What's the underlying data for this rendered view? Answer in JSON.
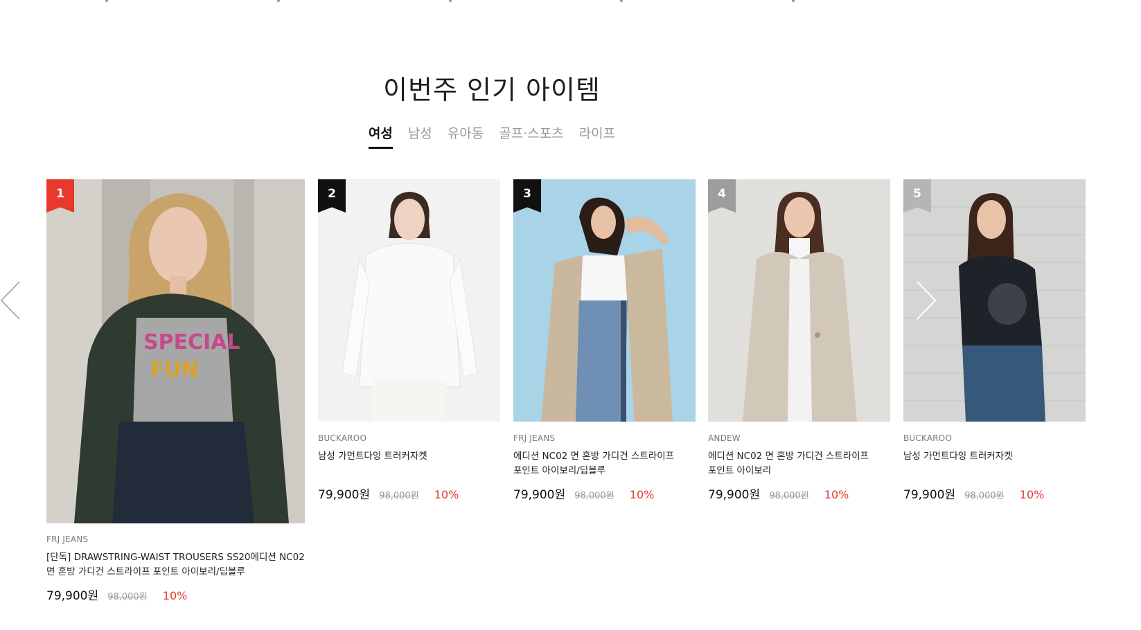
{
  "section": {
    "title": "이번주 인기 아이템"
  },
  "tabs": [
    {
      "label": "여성",
      "active": true
    },
    {
      "label": "남성",
      "active": false
    },
    {
      "label": "유아동",
      "active": false
    },
    {
      "label": "골프·스포츠",
      "active": false
    },
    {
      "label": "라이프",
      "active": false
    }
  ],
  "products": [
    {
      "rank": "1",
      "rank_color": "#e8392c",
      "brand": "FRJ JEANS",
      "name_line1": "[단독] DRAWSTRING-WAIST TROUSERS SS20에디션 NC02",
      "name_line2": "면 혼방 가디건 스트라이프 포인트 아이보리/딥블루",
      "price": "79,900원",
      "old_price": "98,000원",
      "discount": "10%"
    },
    {
      "rank": "2",
      "rank_color": "#111111",
      "brand": "BUCKAROO",
      "name_line1": "남성 가먼트다잉 트러커자켓",
      "name_line2": "",
      "price": "79,900원",
      "old_price": "98,000원",
      "discount": "10%"
    },
    {
      "rank": "3",
      "rank_color": "#111111",
      "brand": "FRJ JEANS",
      "name_line1": "에디션 NC02 면 혼방 가디건 스트라이프",
      "name_line2": "포인트 아이보리/딥블루",
      "price": "79,900원",
      "old_price": "98,000원",
      "discount": "10%"
    },
    {
      "rank": "4",
      "rank_color": "#9d9d9d",
      "brand": "ANDEW",
      "name_line1": "에디션 NC02 면 혼방 가디건 스트라이프",
      "name_line2": "포인트 아이보리",
      "price": "79,900원",
      "old_price": "98,000원",
      "discount": "10%"
    },
    {
      "rank": "5",
      "rank_color": "#b5b5b5",
      "brand": "BUCKAROO",
      "name_line1": "남성 가먼트다잉 트러커자켓",
      "name_line2": "",
      "price": "79,900원",
      "old_price": "98,000원",
      "discount": "10%"
    }
  ],
  "icons": {
    "prev": "chevron-left-icon",
    "next": "chevron-right-icon"
  }
}
